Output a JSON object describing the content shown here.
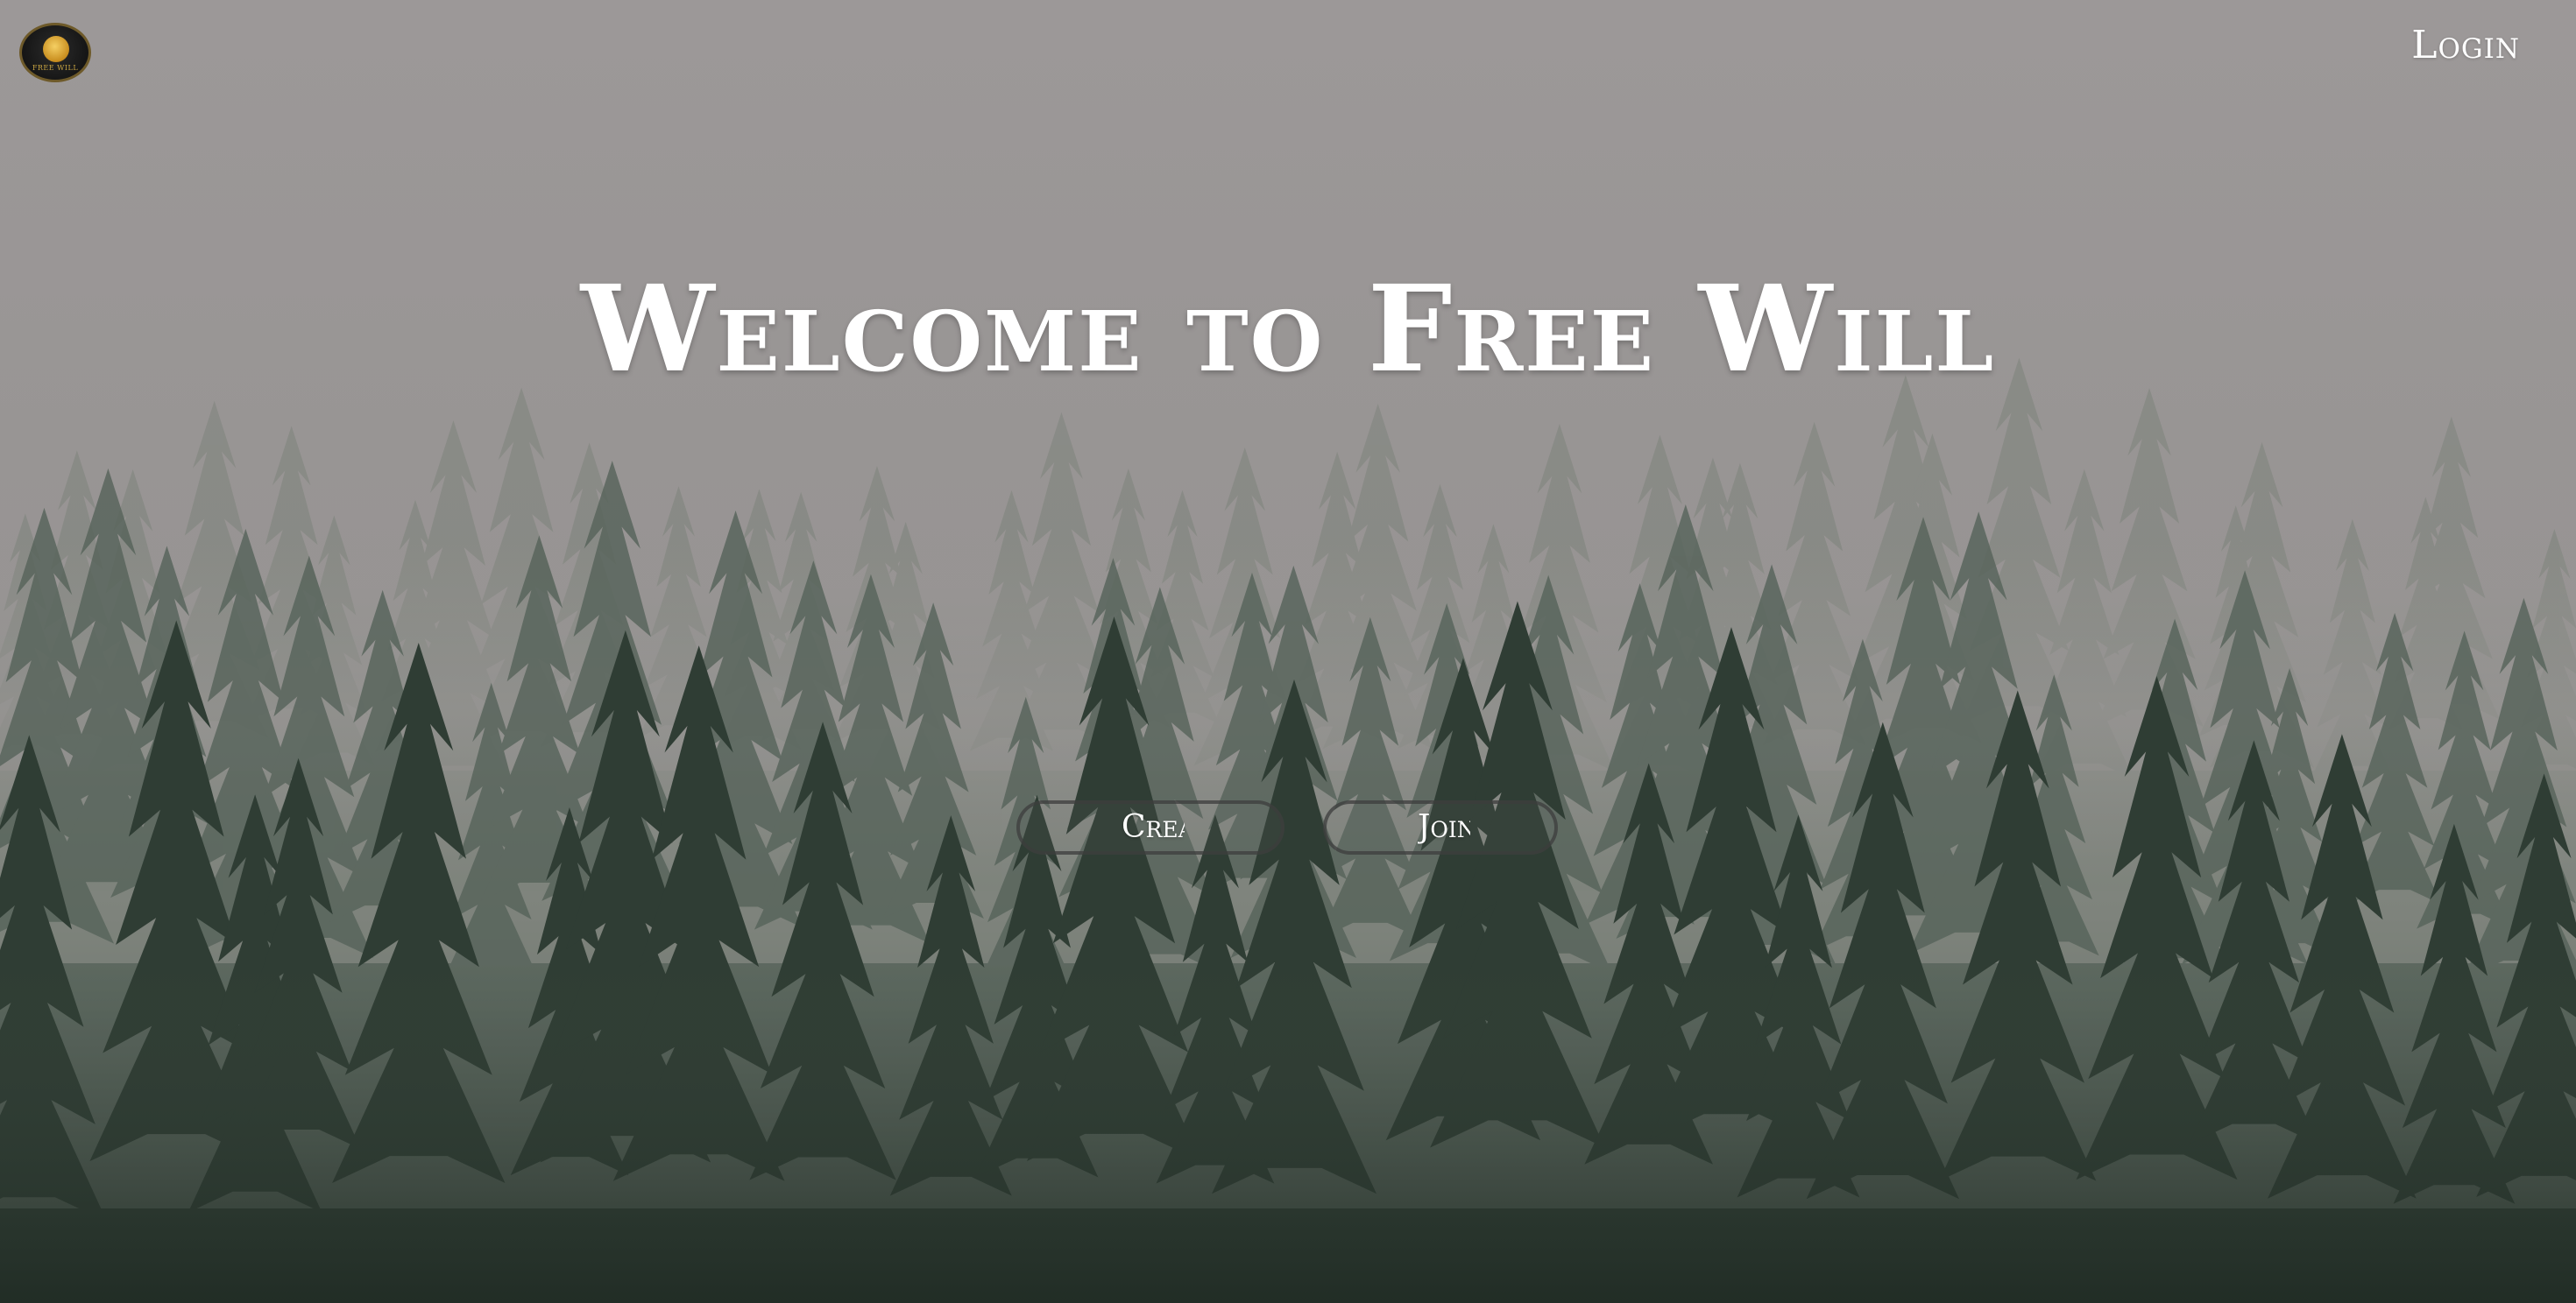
{
  "header": {
    "logo_text": "FREE WILL",
    "login_label": "Login"
  },
  "hero": {
    "title": "Welcome to Free Will",
    "create_button_label": "Create",
    "join_button_label": "Join"
  },
  "colors": {
    "sky": "#9b9797",
    "forest_dark": "#2c3a31",
    "text": "#ffffff",
    "logo_gold": "#c9a542"
  },
  "icons": {
    "logo": "free-will-emblem-icon"
  }
}
